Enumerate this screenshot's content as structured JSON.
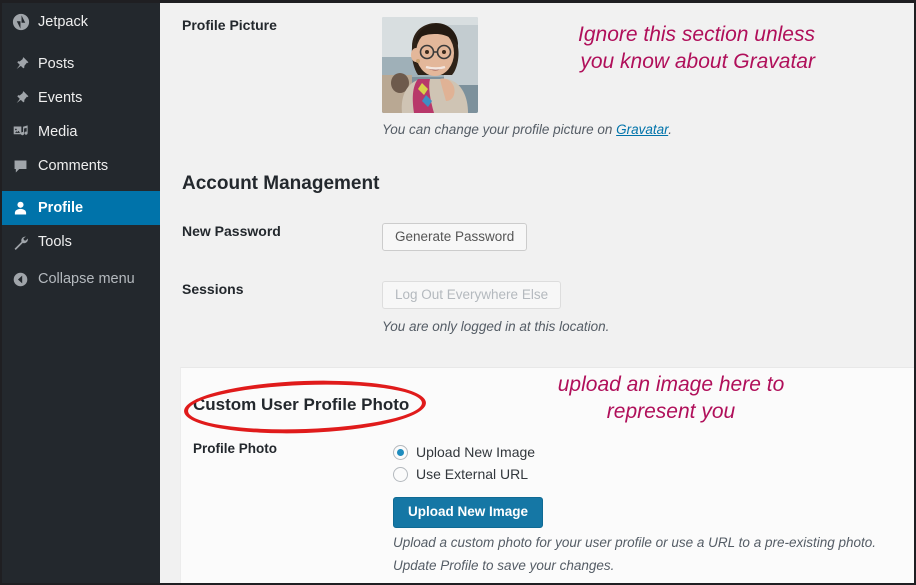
{
  "sidebar": {
    "items": [
      {
        "label": "Jetpack",
        "icon": "jetpack-icon",
        "state": "normal"
      },
      {
        "label": "Posts",
        "icon": "pin-icon",
        "state": "normal"
      },
      {
        "label": "Events",
        "icon": "pin-icon",
        "state": "normal"
      },
      {
        "label": "Media",
        "icon": "media-icon",
        "state": "normal"
      },
      {
        "label": "Comments",
        "icon": "comment-icon",
        "state": "normal"
      },
      {
        "label": "Profile",
        "icon": "user-icon",
        "state": "active"
      },
      {
        "label": "Tools",
        "icon": "wrench-icon",
        "state": "normal"
      },
      {
        "label": "Collapse menu",
        "icon": "collapse-arrow-icon",
        "state": "dim"
      }
    ]
  },
  "profile_picture": {
    "label": "Profile Picture",
    "avatar_alt": "profile-photo-of-user",
    "description_prefix": "You can change your profile picture on ",
    "description_link": "Gravatar",
    "description_suffix": "."
  },
  "account_management": {
    "title": "Account Management",
    "new_password": {
      "label": "New Password",
      "button": "Generate Password"
    },
    "sessions": {
      "label": "Sessions",
      "button": "Log Out Everywhere Else",
      "note": "You are only logged in at this location."
    }
  },
  "custom_user_profile_photo": {
    "title": "Custom User Profile Photo",
    "profile_photo_label": "Profile Photo",
    "radios": [
      {
        "label": "Upload New Image",
        "checked": true
      },
      {
        "label": "Use External URL",
        "checked": false
      }
    ],
    "upload_button": "Upload New Image",
    "help_line_1": "Upload a custom photo for your user profile or use a URL to a pre-existing photo.",
    "help_line_2": "Update Profile to save your changes."
  },
  "annotations": {
    "gravatar_note": "Ignore this section unless\nyou know about Gravatar",
    "upload_note": "upload an image here to\nrepresent you",
    "color": "#b00f5a",
    "ellipse_color": "#e01b1b"
  }
}
